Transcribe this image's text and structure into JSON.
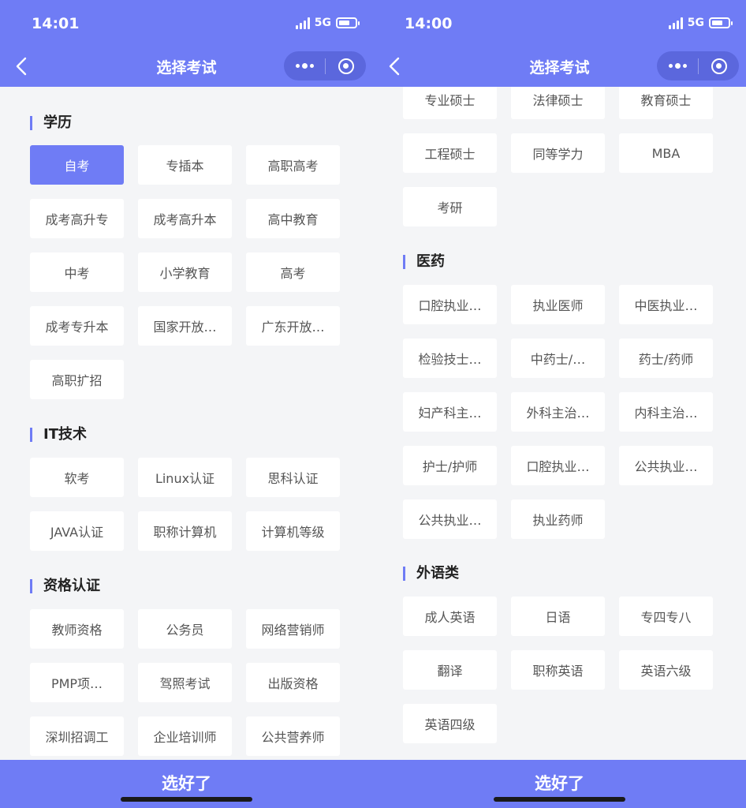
{
  "left": {
    "status_time": "14:01",
    "network": "5G",
    "title": "选择考试",
    "sections": [
      {
        "title": "学历",
        "items": [
          "自考",
          "专插本",
          "高职高考",
          "成考高升专",
          "成考高升本",
          "高中教育",
          "中考",
          "小学教育",
          "高考",
          "成考专升本",
          "国家开放…",
          "广东开放…",
          "高职扩招"
        ]
      },
      {
        "title": "IT技术",
        "items": [
          "软考",
          "Linux认证",
          "思科认证",
          "JAVA认证",
          "职称计算机",
          "计算机等级"
        ]
      },
      {
        "title": "资格认证",
        "items": [
          "教师资格",
          "公务员",
          "网络营销师",
          "PMP项…",
          "驾照考试",
          "出版资格",
          "深圳招调工",
          "企业培训师",
          "公共营养师"
        ]
      }
    ],
    "selected_item": "自考",
    "submit_label": "选好了"
  },
  "right": {
    "status_time": "14:00",
    "network": "5G",
    "title": "选择考试",
    "top_items": [
      "专业硕士",
      "法律硕士",
      "教育硕士",
      "工程硕士",
      "同等学力",
      "MBA",
      "考研"
    ],
    "sections": [
      {
        "title": "医药",
        "items": [
          "口腔执业…",
          "执业医师",
          "中医执业…",
          "检验技士…",
          "中药士/…",
          "药士/药师",
          "妇产科主…",
          "外科主治…",
          "内科主治…",
          "护士/护师",
          "口腔执业…",
          "公共执业…",
          "公共执业…",
          "执业药师"
        ]
      },
      {
        "title": "外语类",
        "items": [
          "成人英语",
          "日语",
          "专四专八",
          "翻译",
          "职称英语",
          "英语六级",
          "英语四级"
        ]
      }
    ],
    "submit_label": "选好了"
  },
  "colors": {
    "accent": "#6f7cf5",
    "capsule": "#5b67dd",
    "background": "#f4f5f7",
    "tag_text": "#555555"
  },
  "icons": [
    "back-arrow-icon",
    "more-dots-icon",
    "close-target-icon",
    "signal-icon",
    "battery-icon"
  ]
}
